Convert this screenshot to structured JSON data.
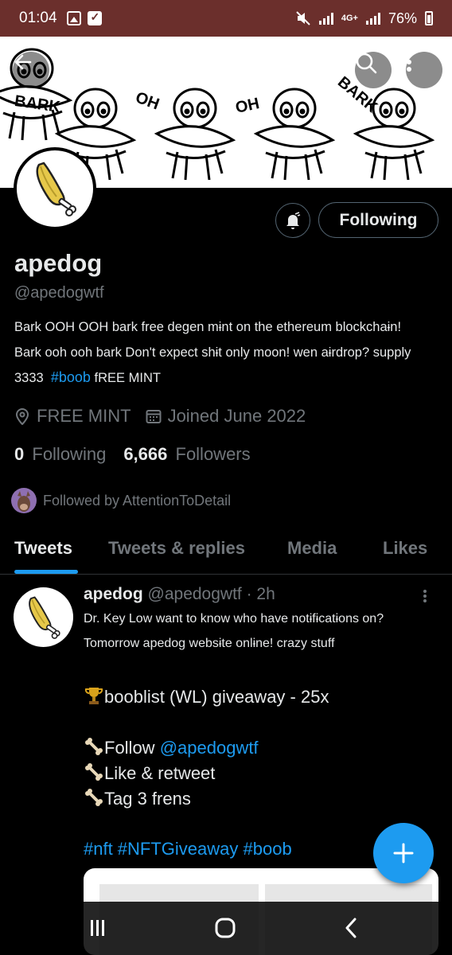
{
  "status_bar": {
    "time": "01:04",
    "network": "4G+",
    "battery": "76%"
  },
  "banner": {
    "words": [
      "BARK",
      "OH",
      "OH",
      "BARK"
    ]
  },
  "profile": {
    "name": "apedog",
    "handle": "@apedogwtf",
    "following_button": "Following",
    "bio": "Bark OOH OOH bark free degen mɨnt on the ethereum blockchaɨn! Bark ooh ooh bark Don't expect shɨt only moon! wen aɨrdrop? supply 3333",
    "bio_hashtag": "#boob",
    "bio_tail": "fREE MINT",
    "location": "FREE MINT",
    "joined": "Joined June 2022",
    "following_count": "0",
    "following_label": "Following",
    "followers_count": "6,666",
    "followers_label": "Followers",
    "followed_by": "Followed by AttentionToDetail"
  },
  "tabs": [
    {
      "label": "Tweets",
      "active": true
    },
    {
      "label": "Tweets & replies",
      "active": false
    },
    {
      "label": "Media",
      "active": false
    },
    {
      "label": "Likes",
      "active": false
    }
  ],
  "tweet": {
    "name": "apedog",
    "handle": "@apedogwtf",
    "time": "· 2h",
    "text": "Dr. Key Low want to know who have notɨfɨcatɨons on? Tomorrow apedog websɨte onlɨne! crazy stuff",
    "giveaway": "booblist (WL) giveaway - 25x",
    "follow_prefix": "Follow ",
    "follow_link": "@apedogwtf",
    "like_retweet": "Like & retweet",
    "tag_frens": "Tag 3 frens",
    "hashtags": "#nft #NFTGiveaway  #boob"
  },
  "icons": {
    "back": "back-arrow-icon",
    "search": "search-icon",
    "more": "more-vertical-icon",
    "bell": "notification-bell-icon",
    "location": "location-icon",
    "calendar": "calendar-icon",
    "trophy": "trophy-emoji",
    "bone": "bone-emoji",
    "compose": "plus-icon"
  },
  "colors": {
    "status_bar": "#6b2f2c",
    "accent": "#1d9bf0",
    "background": "#000000",
    "secondary_text": "#71767b"
  }
}
